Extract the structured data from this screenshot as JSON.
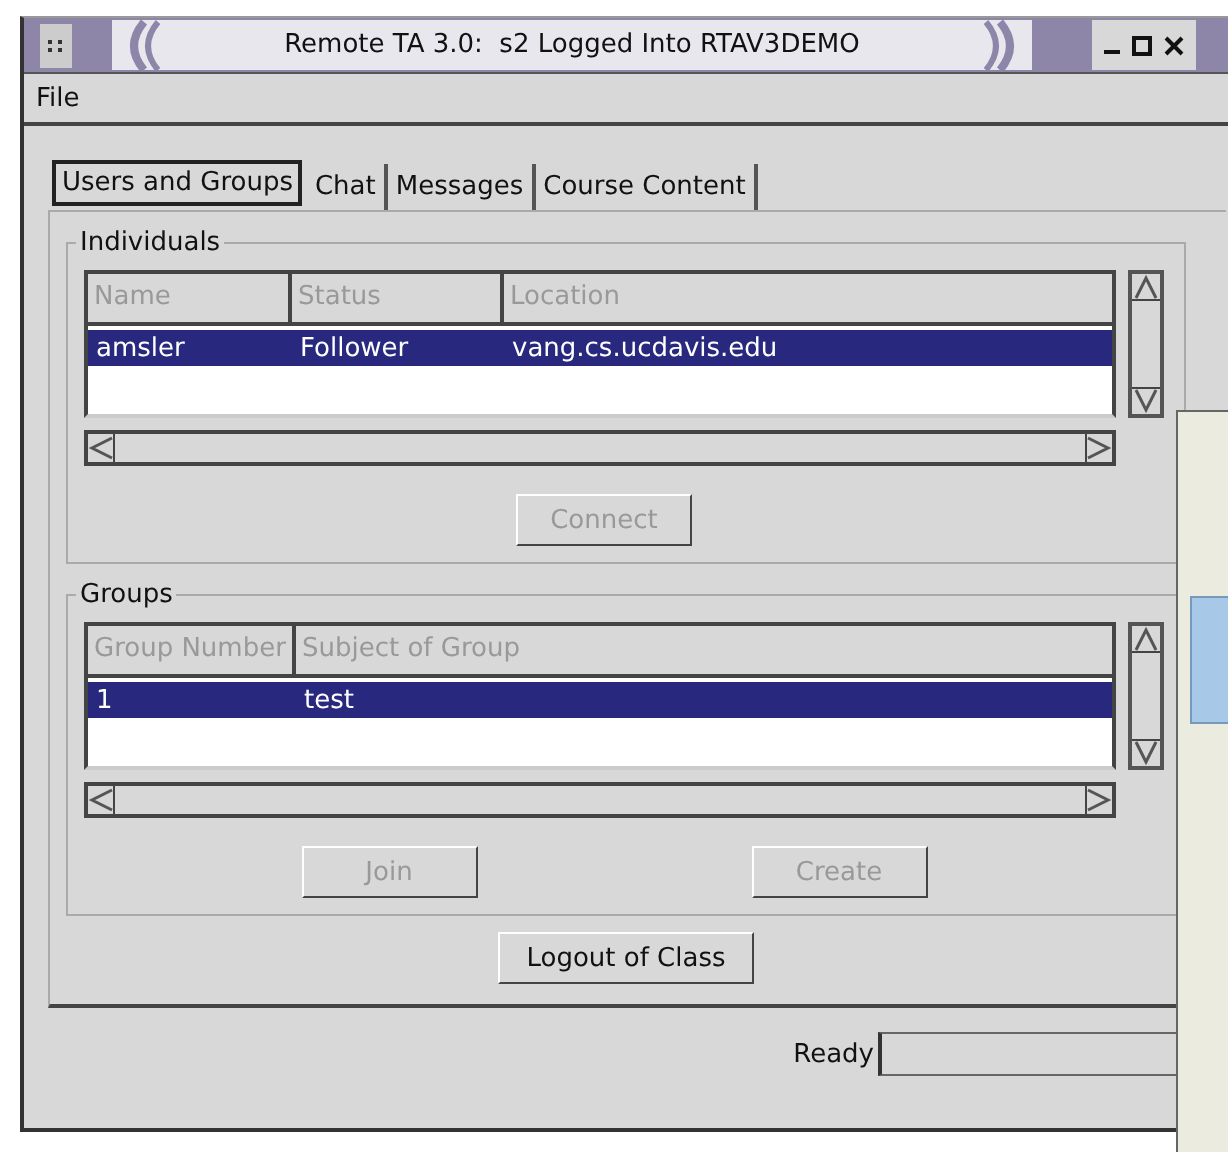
{
  "window": {
    "title": "Remote TA 3.0:  s2 Logged Into RTAV3DEMO"
  },
  "menu": [
    "File"
  ],
  "tabs": [
    {
      "label": "Users and Groups",
      "selected": true
    },
    {
      "label": "Chat",
      "selected": false
    },
    {
      "label": "Messages",
      "selected": false
    },
    {
      "label": "Course Content",
      "selected": false
    }
  ],
  "individuals": {
    "title": "Individuals",
    "columns": [
      "Name",
      "Status",
      "Location"
    ],
    "rows": [
      {
        "cells": [
          "amsler",
          "Follower",
          "vang.cs.ucdavis.edu"
        ],
        "selected": true
      }
    ],
    "buttons": [
      {
        "label": "Connect",
        "disabled": true
      }
    ]
  },
  "groups": {
    "title": "Groups",
    "columns": [
      "Group Number",
      "Subject of Group"
    ],
    "rows": [
      {
        "cells": [
          "1",
          "test"
        ],
        "selected": true
      }
    ],
    "buttons": [
      {
        "label": "Join",
        "disabled": true
      },
      {
        "label": "Create",
        "disabled": true
      }
    ]
  },
  "logout_button": {
    "label": "Logout of Class",
    "disabled": false
  },
  "status_bar": {
    "text": "Ready"
  }
}
